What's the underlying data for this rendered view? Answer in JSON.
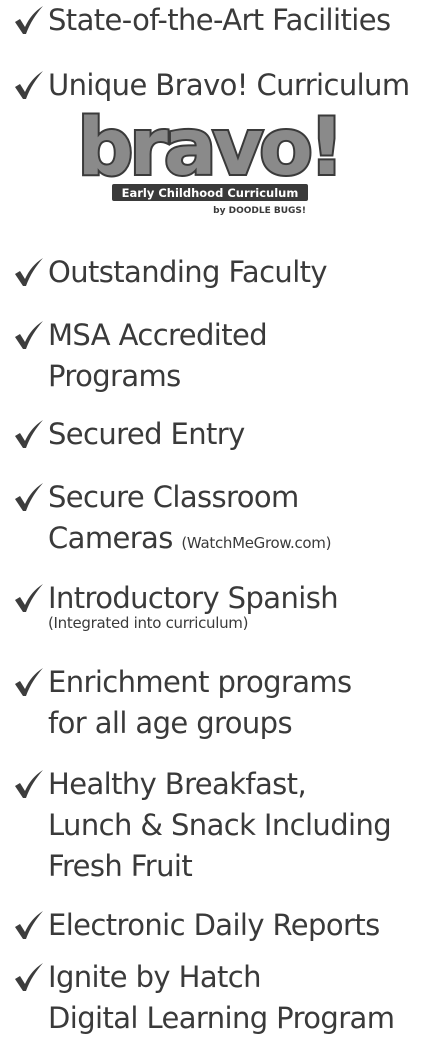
{
  "features": [
    {
      "text": "State-of-the-Art Facilities"
    },
    {
      "text": "Unique Bravo! Curriculum"
    },
    {
      "text": "Outstanding Faculty"
    },
    {
      "line1": "MSA Accredited",
      "line2": "Programs"
    },
    {
      "text": "Secured Entry"
    },
    {
      "line1": "Secure Classroom",
      "line2": "Cameras",
      "note": "(WatchMeGrow.com)"
    },
    {
      "text": "Introductory Spanish",
      "sub": "(Integrated into curriculum)"
    },
    {
      "line1": "Enrichment programs",
      "line2": "for all age groups"
    },
    {
      "line1": "Healthy Breakfast,",
      "line2": "Lunch & Snack Including",
      "line3": "Fresh Fruit"
    },
    {
      "text": "Electronic Daily Reports"
    },
    {
      "line1": "Ignite by Hatch",
      "line2": "Digital Learning Program"
    }
  ],
  "logo": {
    "wordmark": "bravo!",
    "banner": "Early Childhood Curriculum",
    "byline": "by DOODLE BUGS!"
  },
  "colors": {
    "text": "#3a3a3a",
    "check": "#3d3d3d",
    "logo_fill": "#8a8a8a",
    "logo_outline": "#3a3a3a",
    "banner": "#3a3a3a"
  },
  "icons": {
    "bullet": "check-mark-icon"
  }
}
